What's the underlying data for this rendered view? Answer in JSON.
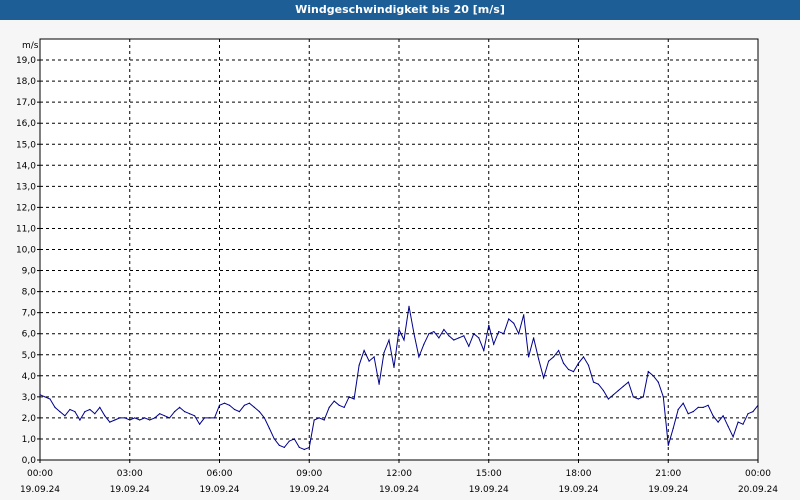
{
  "window": {
    "title": "Windgeschwindigkeit bis 20 [m/s]"
  },
  "chart_data": {
    "type": "line",
    "title": "Windgeschwindigkeit bis 20 [m/s]",
    "ylabel": "m/s",
    "xlabel": "",
    "ylim": [
      0,
      20
    ],
    "xlim": [
      "19.09.24 00:00",
      "20.09.24 00:00"
    ],
    "grid": true,
    "colors": {
      "series": "#00008b",
      "grid": "#000000",
      "background": "#ffffff"
    },
    "y_ticks": [
      "0,0",
      "1,0",
      "2,0",
      "3,0",
      "4,0",
      "5,0",
      "6,0",
      "7,0",
      "8,0",
      "9,0",
      "10,0",
      "11,0",
      "12,0",
      "13,0",
      "14,0",
      "15,0",
      "16,0",
      "17,0",
      "18,0",
      "19,0"
    ],
    "x_ticks": [
      {
        "time": "00:00",
        "date": "19.09.24"
      },
      {
        "time": "03:00",
        "date": "19.09.24"
      },
      {
        "time": "06:00",
        "date": "19.09.24"
      },
      {
        "time": "09:00",
        "date": "19.09.24"
      },
      {
        "time": "12:00",
        "date": "19.09.24"
      },
      {
        "time": "15:00",
        "date": "19.09.24"
      },
      {
        "time": "18:00",
        "date": "19.09.24"
      },
      {
        "time": "21:00",
        "date": "19.09.24"
      },
      {
        "time": "00:00",
        "date": "20.09.24"
      }
    ],
    "series": [
      {
        "x": [
          "00:00",
          "00:10",
          "00:20",
          "00:30",
          "00:40",
          "00:50",
          "01:00",
          "01:10",
          "01:20",
          "01:30",
          "01:40",
          "01:50",
          "02:00",
          "02:10",
          "02:20",
          "02:30",
          "02:40",
          "02:50",
          "03:00",
          "03:10",
          "03:20",
          "03:30",
          "03:40",
          "03:50",
          "04:00",
          "04:10",
          "04:20",
          "04:30",
          "04:40",
          "04:50",
          "05:00",
          "05:10",
          "05:20",
          "05:30",
          "05:40",
          "05:50",
          "06:00",
          "06:10",
          "06:20",
          "06:30",
          "06:40",
          "06:50",
          "07:00",
          "07:10",
          "07:20",
          "07:30",
          "07:40",
          "07:50",
          "08:00",
          "08:10",
          "08:20",
          "08:30",
          "08:40",
          "08:50",
          "09:00",
          "09:10",
          "09:20",
          "09:30",
          "09:40",
          "09:50",
          "10:00",
          "10:10",
          "10:20",
          "10:30",
          "10:40",
          "10:50",
          "11:00",
          "11:10",
          "11:20",
          "11:30",
          "11:40",
          "11:50",
          "12:00",
          "12:10",
          "12:20",
          "12:30",
          "12:40",
          "12:50",
          "13:00",
          "13:10",
          "13:20",
          "13:30",
          "13:40",
          "13:50",
          "14:00",
          "14:10",
          "14:20",
          "14:30",
          "14:40",
          "14:50",
          "15:00",
          "15:10",
          "15:20",
          "15:30",
          "15:40",
          "15:50",
          "16:00",
          "16:10",
          "16:20",
          "16:30",
          "16:40",
          "16:50",
          "17:00",
          "17:10",
          "17:20",
          "17:30",
          "17:40",
          "17:50",
          "18:00",
          "18:10",
          "18:20",
          "18:30",
          "18:40",
          "18:50",
          "19:00",
          "19:10",
          "19:20",
          "19:30",
          "19:40",
          "19:50",
          "20:00",
          "20:10",
          "20:20",
          "20:30",
          "20:40",
          "20:50",
          "21:00",
          "21:10",
          "21:20",
          "21:30",
          "21:40",
          "21:50",
          "22:00",
          "22:10",
          "22:20",
          "22:30",
          "22:40",
          "22:50",
          "23:00",
          "23:10",
          "23:20",
          "23:30",
          "23:40",
          "23:50",
          "24:00"
        ],
        "y": [
          3.1,
          3.0,
          2.9,
          2.5,
          2.3,
          2.1,
          2.4,
          2.3,
          1.9,
          2.3,
          2.4,
          2.2,
          2.5,
          2.1,
          1.8,
          1.9,
          2.0,
          2.0,
          1.9,
          2.0,
          1.9,
          2.0,
          1.9,
          2.0,
          2.2,
          2.1,
          2.0,
          2.3,
          2.5,
          2.3,
          2.2,
          2.1,
          1.7,
          2.0,
          2.0,
          2.0,
          2.6,
          2.7,
          2.6,
          2.4,
          2.3,
          2.6,
          2.7,
          2.5,
          2.3,
          2.0,
          1.5,
          1.0,
          0.7,
          0.6,
          0.9,
          1.0,
          0.6,
          0.5,
          0.6,
          1.9,
          2.0,
          1.9,
          2.5,
          2.8,
          2.6,
          2.5,
          3.0,
          2.9,
          4.5,
          5.2,
          4.7,
          4.9,
          3.6,
          5.1,
          5.7,
          4.4,
          6.2,
          5.7,
          7.3,
          6.0,
          4.9,
          5.5,
          6.0,
          6.1,
          5.8,
          6.2,
          5.9,
          5.7,
          5.8,
          5.9,
          5.4,
          6.0,
          5.8,
          5.2,
          6.4,
          5.5,
          6.1,
          6.0,
          6.7,
          6.5,
          6.0,
          6.9,
          4.9,
          5.8,
          4.8,
          3.9,
          4.7,
          4.9,
          5.2,
          4.6,
          4.3,
          4.2,
          4.6,
          4.9,
          4.5,
          3.7,
          3.6,
          3.3,
          2.9,
          3.1,
          3.3,
          3.5,
          3.7,
          3.0,
          2.9,
          3.0,
          4.2,
          4.0,
          3.7,
          3.0,
          0.7,
          1.5,
          2.4,
          2.7,
          2.2,
          2.3,
          2.5,
          2.5,
          2.6,
          2.1,
          1.8,
          2.1,
          1.6,
          1.1,
          1.8,
          1.7,
          2.2,
          2.3,
          2.6
        ]
      }
    ]
  }
}
